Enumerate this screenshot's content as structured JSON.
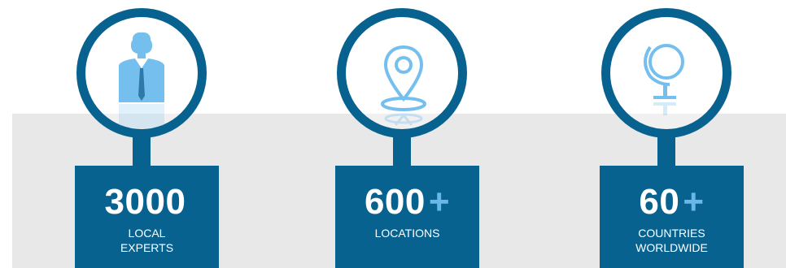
{
  "stats": [
    {
      "number": "3000",
      "suffix": "",
      "label": "LOCAL\nEXPERTS",
      "icon": "businessman-icon"
    },
    {
      "number": "600",
      "suffix": "+",
      "label": "LOCATIONS",
      "icon": "location-pin-icon"
    },
    {
      "number": "60",
      "suffix": "+",
      "label": "COUNTRIES\nWORLDWIDE",
      "icon": "globe-icon"
    }
  ],
  "colors": {
    "ring": "#07628f",
    "card": "#07628f",
    "icon": "#74bfee",
    "plus": "#69b8e8",
    "band": "#e8e8e8"
  }
}
